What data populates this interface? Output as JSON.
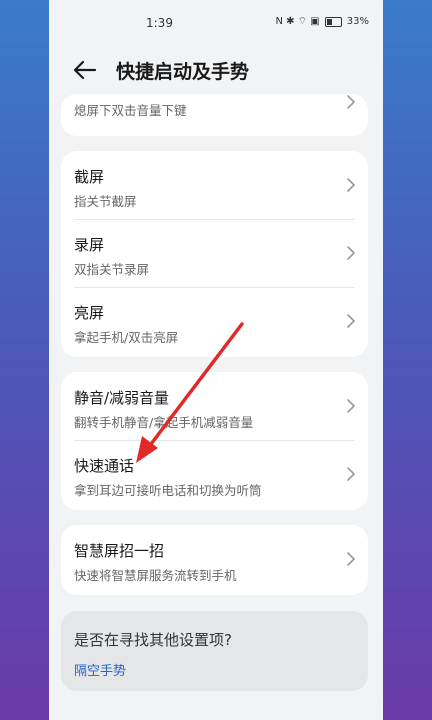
{
  "status_bar": {
    "time": "1:39",
    "icons_text": "N ✱ ⌔ ▣",
    "battery_percent": "33%"
  },
  "header": {
    "title": "快捷启动及手势"
  },
  "partial_card": {
    "subtitle": "熄屏下双击音量下键"
  },
  "group1": [
    {
      "title": "截屏",
      "subtitle": "指关节截屏"
    },
    {
      "title": "录屏",
      "subtitle": "双指关节录屏"
    },
    {
      "title": "亮屏",
      "subtitle": "拿起手机/双击亮屏"
    }
  ],
  "group2": [
    {
      "title": "静音/减弱音量",
      "subtitle": "翻转手机静音/拿起手机减弱音量"
    },
    {
      "title": "快速通话",
      "subtitle": "拿到耳边可接听电话和切换为听筒"
    }
  ],
  "group3": [
    {
      "title": "智慧屏招一招",
      "subtitle": "快速将智慧屏服务流转到手机"
    }
  ],
  "search_suggest": {
    "question": "是否在寻找其他设置项?",
    "link": "隔空手势"
  },
  "colors": {
    "annotation_arrow": "#e02a2a",
    "link": "#2a64c8"
  }
}
